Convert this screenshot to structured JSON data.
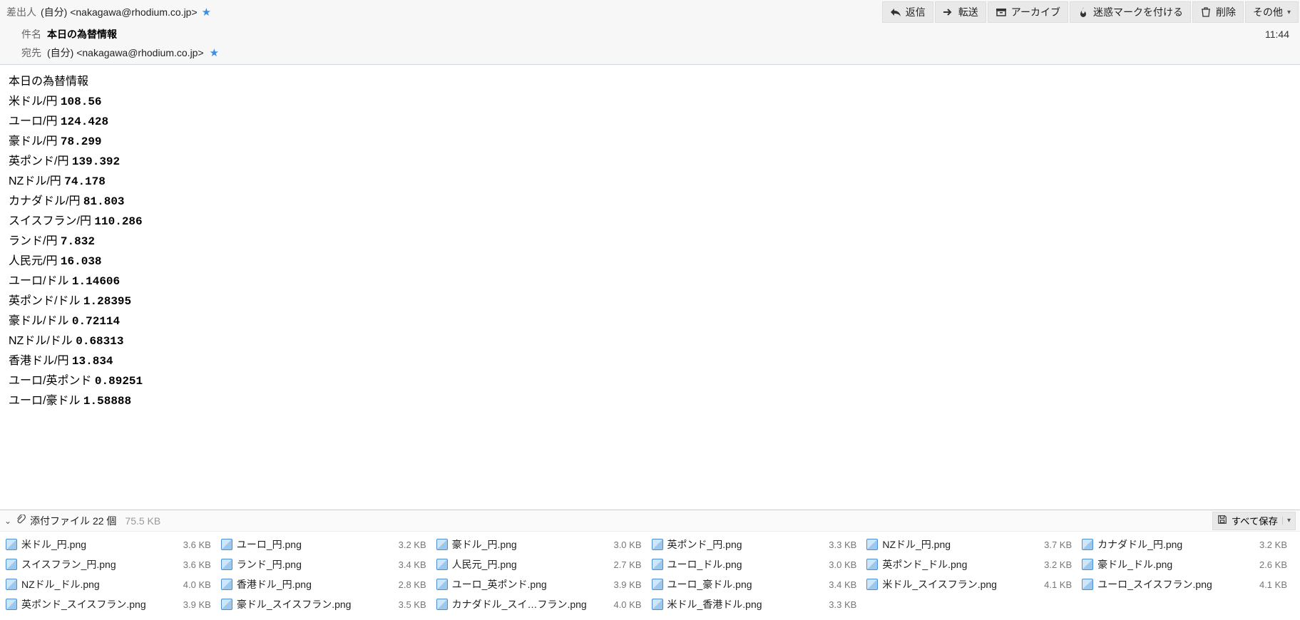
{
  "header": {
    "from_label": "差出人",
    "from_value": "(自分) <nakagawa@rhodium.co.jp>",
    "subject_label": "件名",
    "subject": "本日の為替情報",
    "to_label": "宛先",
    "to_value": "(自分) <nakagawa@rhodium.co.jp>",
    "time": "11:44"
  },
  "toolbar": {
    "reply": "返信",
    "forward": "転送",
    "archive": "アーカイブ",
    "junk": "迷惑マークを付ける",
    "delete": "削除",
    "other": "その他"
  },
  "body": {
    "title": "本日の為替情報",
    "rates": [
      {
        "pair": "米ドル/円",
        "rate": "108.56"
      },
      {
        "pair": "ユーロ/円",
        "rate": "124.428"
      },
      {
        "pair": "豪ドル/円",
        "rate": "78.299"
      },
      {
        "pair": "英ポンド/円",
        "rate": "139.392"
      },
      {
        "pair": "NZドル/円",
        "rate": "74.178"
      },
      {
        "pair": "カナダドル/円",
        "rate": "81.803"
      },
      {
        "pair": "スイスフラン/円",
        "rate": "110.286"
      },
      {
        "pair": "ランド/円",
        "rate": "7.832"
      },
      {
        "pair": "人民元/円",
        "rate": "16.038"
      },
      {
        "pair": "ユーロ/ドル",
        "rate": "1.14606"
      },
      {
        "pair": "英ポンド/ドル",
        "rate": "1.28395"
      },
      {
        "pair": "豪ドル/ドル",
        "rate": "0.72114"
      },
      {
        "pair": "NZドル/ドル",
        "rate": "0.68313"
      },
      {
        "pair": "香港ドル/円",
        "rate": "13.834"
      },
      {
        "pair": "ユーロ/英ポンド",
        "rate": "0.89251"
      },
      {
        "pair": "ユーロ/豪ドル",
        "rate": "1.58888"
      }
    ]
  },
  "attachments": {
    "header_label": "添付ファイル 22 個",
    "total_size": "75.5 KB",
    "save_all": "すべて保存",
    "files": [
      {
        "name": "米ドル_円.png",
        "size": "3.6 KB"
      },
      {
        "name": "ユーロ_円.png",
        "size": "3.2 KB"
      },
      {
        "name": "豪ドル_円.png",
        "size": "3.0 KB"
      },
      {
        "name": "英ポンド_円.png",
        "size": "3.3 KB"
      },
      {
        "name": "NZドル_円.png",
        "size": "3.7 KB"
      },
      {
        "name": "カナダドル_円.png",
        "size": "3.2 KB"
      },
      {
        "name": "スイスフラン_円.png",
        "size": "3.6 KB"
      },
      {
        "name": "ランド_円.png",
        "size": "3.4 KB"
      },
      {
        "name": "人民元_円.png",
        "size": "2.7 KB"
      },
      {
        "name": "ユーロ_ドル.png",
        "size": "3.0 KB"
      },
      {
        "name": "英ポンド_ドル.png",
        "size": "3.2 KB"
      },
      {
        "name": "豪ドル_ドル.png",
        "size": "2.6 KB"
      },
      {
        "name": "NZドル_ドル.png",
        "size": "4.0 KB"
      },
      {
        "name": "香港ドル_円.png",
        "size": "2.8 KB"
      },
      {
        "name": "ユーロ_英ポンド.png",
        "size": "3.9 KB"
      },
      {
        "name": "ユーロ_豪ドル.png",
        "size": "3.4 KB"
      },
      {
        "name": "米ドル_スイスフラン.png",
        "size": "4.1 KB"
      },
      {
        "name": "ユーロ_スイスフラン.png",
        "size": "4.1 KB"
      },
      {
        "name": "英ポンド_スイスフラン.png",
        "size": "3.9 KB"
      },
      {
        "name": "豪ドル_スイスフラン.png",
        "size": "3.5 KB"
      },
      {
        "name": "カナダドル_スイ…フラン.png",
        "size": "4.0 KB"
      },
      {
        "name": "米ドル_香港ドル.png",
        "size": "3.3 KB"
      }
    ]
  }
}
